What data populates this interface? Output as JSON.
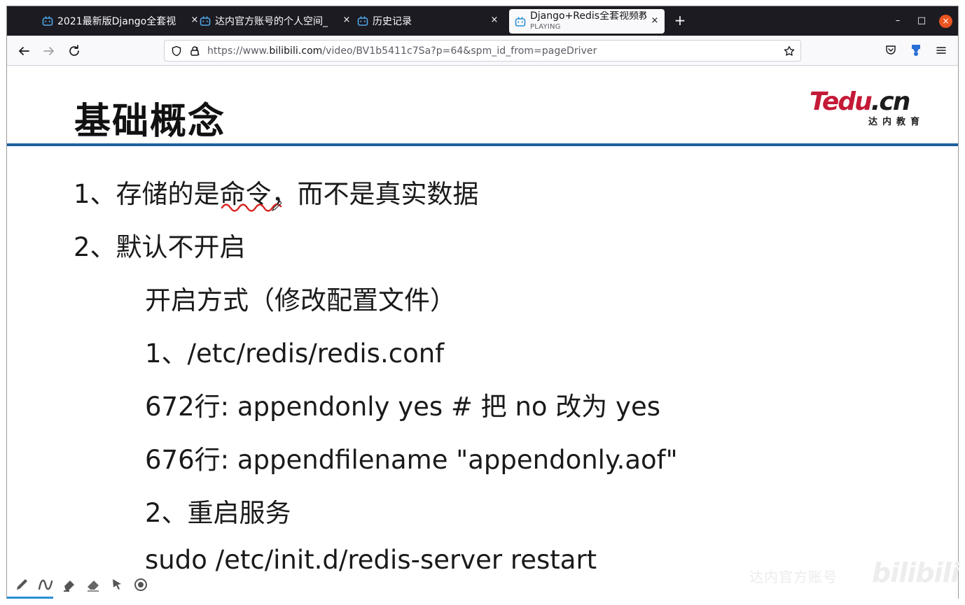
{
  "browser": {
    "tabs": [
      {
        "title": "2021最新版Django全套视",
        "close": "×"
      },
      {
        "title": "达内官方账号的个人空间_",
        "close": "×"
      },
      {
        "title": "历史记录",
        "close": "×"
      },
      {
        "title": "Django+Redis全套视频教",
        "subtitle": "PLAYING",
        "close": "×"
      }
    ],
    "new_tab": "+",
    "window_controls": {
      "minimize": "–",
      "maximize": "□",
      "close": "×"
    },
    "url": {
      "prefix": "https://www.",
      "domain": "bilibili.com",
      "path": "/video/BV1b5411c7Sa?p=64&spm_id_from=pageDriver"
    },
    "accent": "#e95420"
  },
  "slide": {
    "title": "基础概念",
    "logo": {
      "main": "Tedu",
      "dot": ".cn",
      "sub": "达内教育"
    },
    "divider_color": "#1f5f9e",
    "lines": [
      "1、存储的是命令，而不是真实数据",
      "2、默认不开启",
      "开启方式（修改配置文件）",
      "1、/etc/redis/redis.conf",
      "672行: appendonly yes # 把 no 改为 yes",
      "676行: appendfilename \"appendonly.aof\"",
      "2、重启服务",
      "sudo /etc/init.d/redis-server restart"
    ]
  },
  "draw_tools": [
    "pen-icon",
    "curve-icon",
    "highlighter-icon",
    "eraser-icon",
    "pointer-icon",
    "record-icon"
  ],
  "watermark": {
    "text": "达内官方账号",
    "logo": "bilibili"
  }
}
